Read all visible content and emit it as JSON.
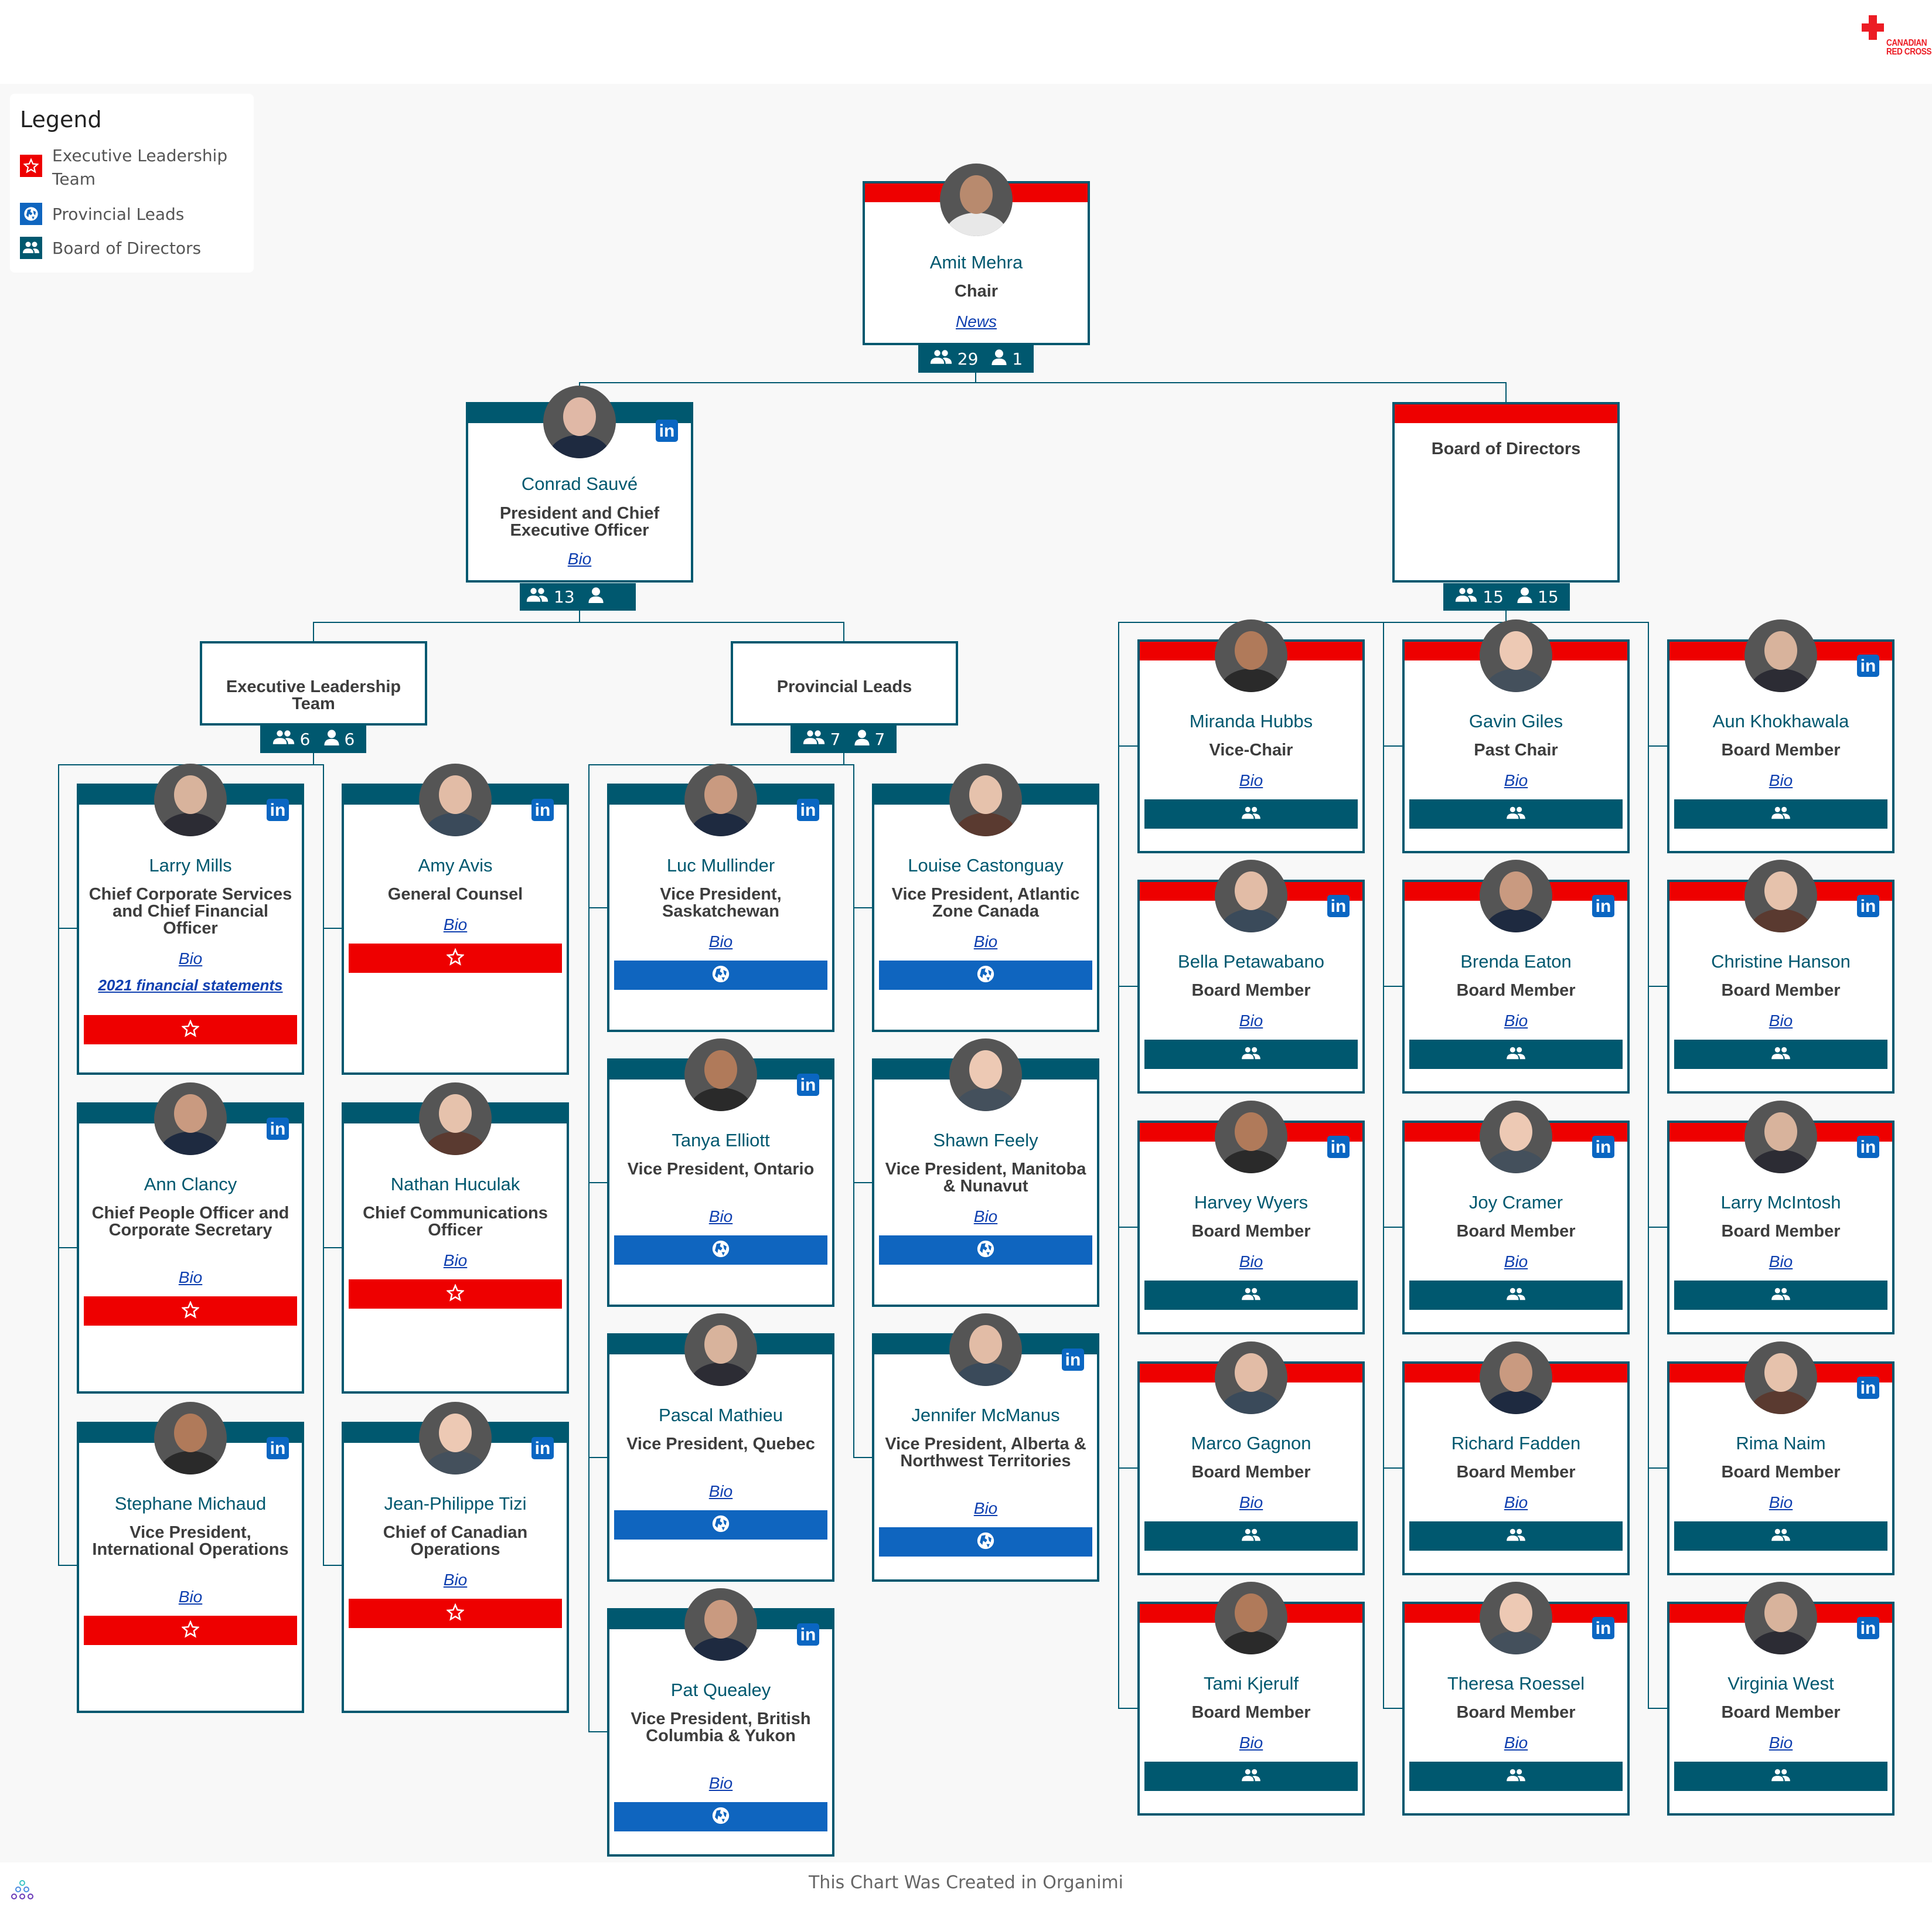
{
  "header": {
    "logo_line1": "CANADIAN",
    "logo_line2": "RED CROSS"
  },
  "legend": {
    "title": "Legend",
    "items": [
      {
        "label": "Executive Leadership Team",
        "icon": "star-icon",
        "color": "#ee0000"
      },
      {
        "label": "Provincial Leads",
        "icon": "globe-icon",
        "color": "#0f65bf"
      },
      {
        "label": "Board of Directors",
        "icon": "group-icon",
        "color": "#00586f"
      }
    ]
  },
  "colors": {
    "teal": "#00586f",
    "red": "#ee0000",
    "blue": "#0f65bf",
    "linkedin": "#0a66c2",
    "link": "#1040b0"
  },
  "root": {
    "name": "Amit Mehra",
    "title": "Chair",
    "link": "News",
    "badge": {
      "team_count": "29",
      "direct_count": "1"
    }
  },
  "ceo": {
    "name": "Conrad Sauvé",
    "title": "President and Chief Executive Officer",
    "link": "Bio",
    "badge": {
      "team_count": "13",
      "direct_count": ""
    }
  },
  "board_group": {
    "title": "Board of Directors",
    "badge": {
      "team_count": "15",
      "direct_count": "15"
    }
  },
  "elt_group": {
    "title": "Executive Leadership Team",
    "badge": {
      "team_count": "6",
      "direct_count": "6"
    },
    "members": [
      {
        "name": "Larry Mills",
        "title": "Chief Corporate Services and Chief Financial Officer",
        "link": "Bio",
        "extra_link": "2021 financial statements",
        "linkedin": true
      },
      {
        "name": "Amy Avis",
        "title": "General Counsel",
        "link": "Bio",
        "linkedin": true
      },
      {
        "name": "Ann Clancy",
        "title": "Chief People Officer and Corporate Secretary",
        "link": "Bio",
        "linkedin": true
      },
      {
        "name": "Nathan Huculak",
        "title": "Chief Communications Officer",
        "link": "Bio",
        "linkedin": false
      },
      {
        "name": "Stephane Michaud",
        "title": "Vice President, International Operations",
        "link": "Bio",
        "linkedin": true
      },
      {
        "name": "Jean-Philippe Tizi",
        "title": "Chief of Canadian Operations",
        "link": "Bio",
        "linkedin": true
      }
    ]
  },
  "pl_group": {
    "title": "Provincial Leads",
    "badge": {
      "team_count": "7",
      "direct_count": "7"
    },
    "members": [
      {
        "name": "Luc Mullinder",
        "title": "Vice President, Saskatchewan",
        "link": "Bio",
        "linkedin": true
      },
      {
        "name": "Louise Castonguay",
        "title": "Vice President, Atlantic Zone Canada",
        "link": "Bio",
        "linkedin": false
      },
      {
        "name": "Tanya Elliott",
        "title": "Vice President, Ontario",
        "link": "Bio",
        "linkedin": true
      },
      {
        "name": "Shawn Feely",
        "title": "Vice President, Manitoba & Nunavut",
        "link": "Bio",
        "linkedin": false
      },
      {
        "name": "Pascal Mathieu",
        "title": "Vice President, Quebec",
        "link": "Bio",
        "linkedin": false
      },
      {
        "name": "Jennifer McManus",
        "title": "Vice President, Alberta & Northwest Territories",
        "link": "Bio",
        "linkedin": true
      },
      {
        "name": "Pat Quealey",
        "title": "Vice President, British Columbia & Yukon",
        "link": "Bio",
        "linkedin": true
      }
    ]
  },
  "board_members": [
    {
      "name": "Miranda Hubbs",
      "title": "Vice-Chair",
      "link": "Bio",
      "linkedin": false
    },
    {
      "name": "Gavin Giles",
      "title": "Past Chair",
      "link": "Bio",
      "linkedin": false
    },
    {
      "name": "Aun Khokhawala",
      "title": "Board Member",
      "link": "Bio",
      "linkedin": true
    },
    {
      "name": "Bella Petawabano",
      "title": "Board Member",
      "link": "Bio",
      "linkedin": true
    },
    {
      "name": "Brenda Eaton",
      "title": "Board Member",
      "link": "Bio",
      "linkedin": true
    },
    {
      "name": "Christine Hanson",
      "title": "Board Member",
      "link": "Bio",
      "linkedin": true
    },
    {
      "name": "Harvey Wyers",
      "title": "Board Member",
      "link": "Bio",
      "linkedin": true
    },
    {
      "name": "Joy Cramer",
      "title": "Board Member",
      "link": "Bio",
      "linkedin": true
    },
    {
      "name": "Larry McIntosh",
      "title": "Board Member",
      "link": "Bio",
      "linkedin": true
    },
    {
      "name": "Marco Gagnon",
      "title": "Board Member",
      "link": "Bio",
      "linkedin": false
    },
    {
      "name": "Richard Fadden",
      "title": "Board Member",
      "link": "Bio",
      "linkedin": false
    },
    {
      "name": "Rima Naim",
      "title": "Board Member",
      "link": "Bio",
      "linkedin": true
    },
    {
      "name": "Tami Kjerulf",
      "title": "Board Member",
      "link": "Bio",
      "linkedin": false
    },
    {
      "name": "Theresa Roessel",
      "title": "Board Member",
      "link": "Bio",
      "linkedin": true
    },
    {
      "name": "Virginia West",
      "title": "Board Member",
      "link": "Bio",
      "linkedin": true
    }
  ],
  "footer": {
    "text": "This Chart Was Created in Organimi"
  }
}
